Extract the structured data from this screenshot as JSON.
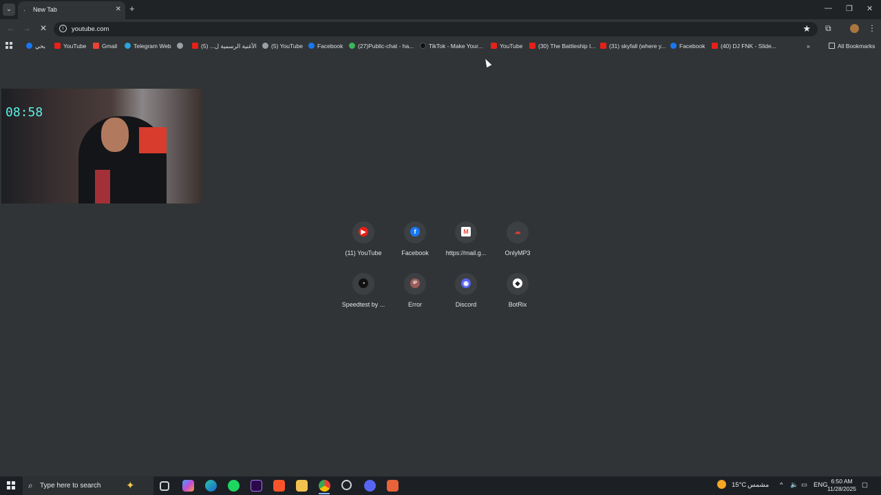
{
  "browser": {
    "tab": {
      "title": "New Tab",
      "favicon": "."
    },
    "address": "youtube.com",
    "window_controls": {
      "minimize": "—",
      "restore": "❐",
      "close": "✕"
    }
  },
  "bookmarks": {
    "items": [
      {
        "label": "بخي",
        "icon": "facebook-icon"
      },
      {
        "label": "YouTube",
        "icon": "youtube-icon"
      },
      {
        "label": "Gmail",
        "icon": "gmail-icon"
      },
      {
        "label": "Telegram Web",
        "icon": "telegram-icon"
      },
      {
        "label": "",
        "icon": "globe-icon"
      },
      {
        "label": "الأغنية الرسمية ل... (5)",
        "icon": "youtube-icon"
      },
      {
        "label": "(5) YouTube",
        "icon": "globe-icon"
      },
      {
        "label": "Facebook",
        "icon": "facebook-icon"
      },
      {
        "label": "(27)Public-chat - ha...",
        "icon": "green-icon"
      },
      {
        "label": "TikTok - Make Your...",
        "icon": "tiktok-icon"
      },
      {
        "label": "YouTube",
        "icon": "youtube-icon"
      },
      {
        "label": "(30) The Battleship I...",
        "icon": "youtube-icon"
      },
      {
        "label": "(31) skyfall (where y...",
        "icon": "youtube-icon"
      },
      {
        "label": "Facebook",
        "icon": "facebook-icon"
      },
      {
        "label": "(40) DJ FNK - Slide...",
        "icon": "youtube-icon"
      }
    ],
    "overflow": "»",
    "all_bookmarks": "All Bookmarks"
  },
  "webcam": {
    "clock": "08:58"
  },
  "shortcuts": [
    {
      "label": "(11) YouTube",
      "icon": "youtube-icon",
      "glyph": "▶",
      "color": "#e62117"
    },
    {
      "label": "Facebook",
      "icon": "facebook-icon",
      "glyph": "f",
      "color": "#1877f2"
    },
    {
      "label": "https://mail.g...",
      "icon": "gmail-icon",
      "glyph": "M",
      "color": "#ea4335"
    },
    {
      "label": "OnlyMP3",
      "icon": "cloud-download-icon",
      "glyph": "☁",
      "color": "#d9403a"
    },
    {
      "label": "Speedtest by ...",
      "icon": "speedtest-icon",
      "glyph": "◔",
      "color": "#111111"
    },
    {
      "label": "Error",
      "icon": "ip-icon",
      "glyph": "IP",
      "color": "#9a5b58"
    },
    {
      "label": "Discord",
      "icon": "discord-icon",
      "glyph": "◉",
      "color": "#5865f2"
    },
    {
      "label": "BotRix",
      "icon": "botrix-icon",
      "glyph": "◆",
      "color": "#ffffff"
    }
  ],
  "taskbar": {
    "search_placeholder": "Type here to search",
    "weather": "15°C",
    "weather_desc": "مشمس",
    "language": "ENG",
    "time": "6:50 AM",
    "date": "11/28/2025"
  }
}
